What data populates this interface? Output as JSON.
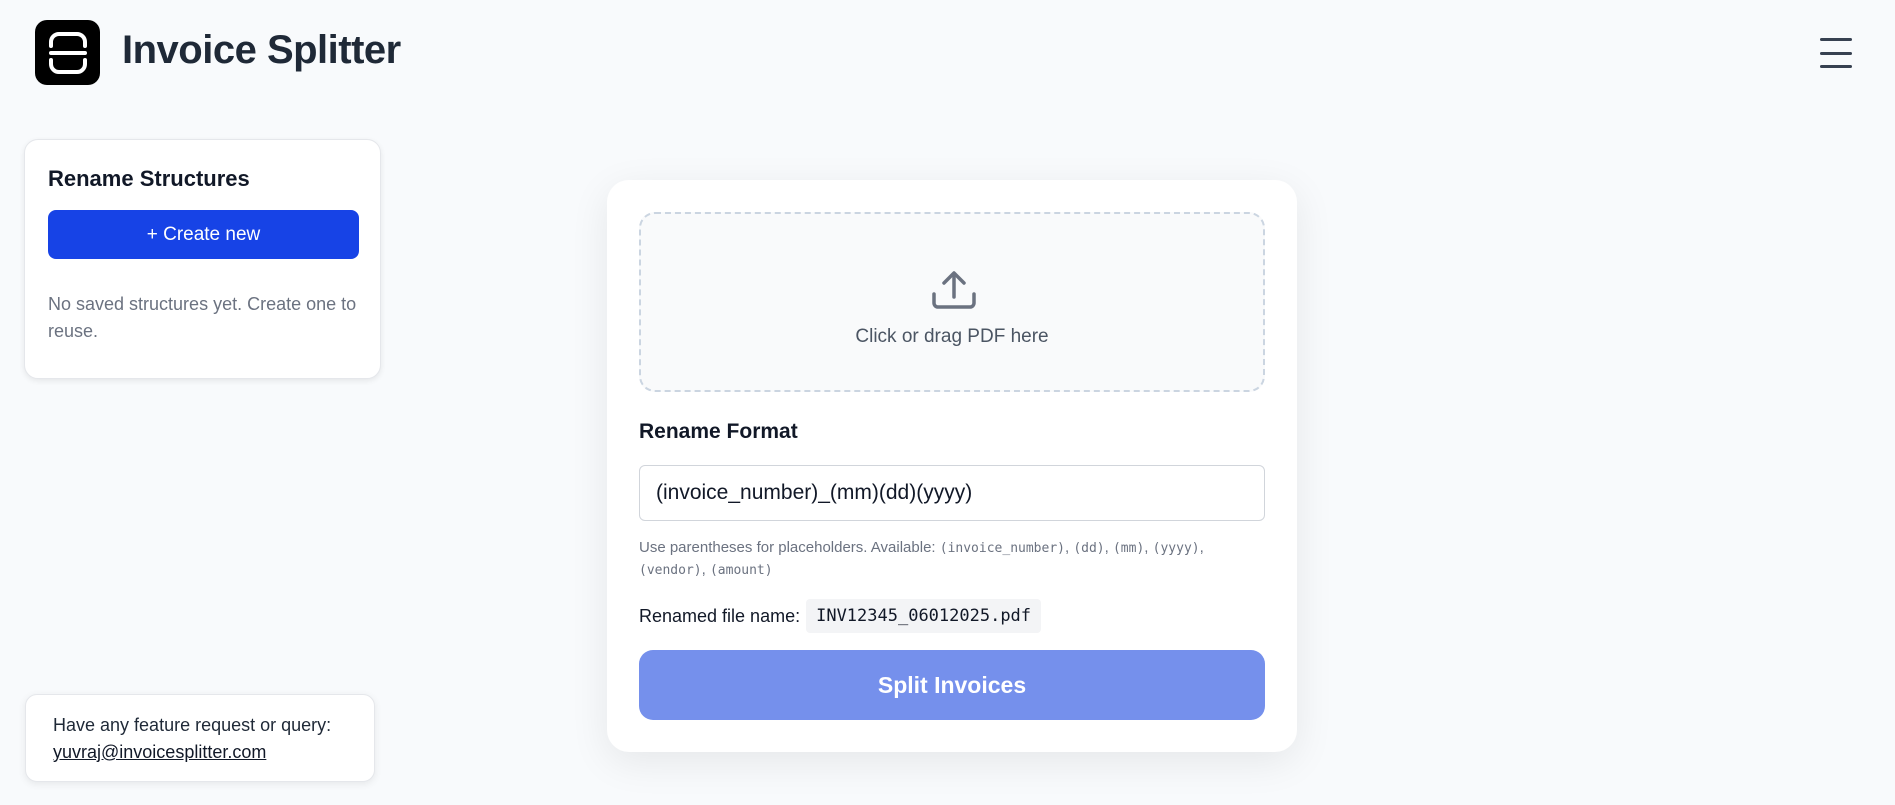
{
  "header": {
    "title": "Invoice Splitter"
  },
  "sidebar": {
    "title": "Rename Structures",
    "create_label": "+ Create new",
    "empty_message": "No saved structures yet. Create one to reuse."
  },
  "main": {
    "dropzone_text": "Click or drag PDF here",
    "format_label": "Rename Format",
    "format_value": "(invoice_number)_(mm)(dd)(yyyy)",
    "help_prefix": "Use parentheses for placeholders. Available: ",
    "placeholders": [
      "(invoice_number)",
      "(dd)",
      "(mm)",
      "(yyyy)",
      "(vendor)",
      "(amount)"
    ],
    "renamed_label": "Renamed file name:",
    "renamed_value": "INV12345_06012025.pdf",
    "split_label": "Split Invoices"
  },
  "footer": {
    "prompt": "Have any feature request or query:",
    "email": "yuvraj@invoicesplitter.com"
  },
  "icons": {
    "logo": "scan-icon",
    "menu": "hamburger-menu-icon",
    "upload": "upload-icon"
  },
  "colors": {
    "primary": "#1743e6",
    "split_button": "#7590ec"
  }
}
